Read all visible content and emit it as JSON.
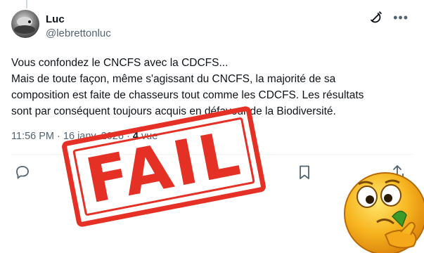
{
  "post": {
    "author_name": "Luc",
    "author_handle": "@lebrettonluc",
    "text_lines": [
      "Vous confondez le CNCFS avec la CDCFS...",
      "Mais de toute façon, même s'agissant du CNCFS, la majorité de sa",
      "composition est faite de chasseurs tout comme les CDCFS. Les résultats",
      "sont par conséquent toujours acquis en défaveur de la Biodiversité."
    ],
    "time": "11:56 PM",
    "separator": "·",
    "date": "16 janv. 2026",
    "views_count": "4",
    "views_label": "vue"
  },
  "icons": {
    "grok": "grok-icon",
    "more": "more-icon",
    "reply": "reply-icon",
    "bookmark": "bookmark-icon",
    "share": "share-icon"
  },
  "stamp": {
    "text": "FAIL",
    "color": "#e53025"
  },
  "colors": {
    "text": "#0f1419",
    "muted": "#536471",
    "stamp_red": "#e53025"
  }
}
